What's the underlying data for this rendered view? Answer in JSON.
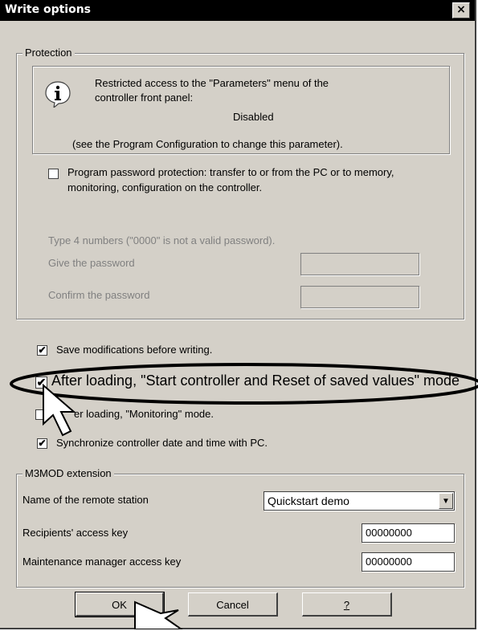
{
  "window": {
    "title": "Write options",
    "close_label": "×"
  },
  "protection": {
    "legend": "Protection",
    "info_line1": "Restricted access to the \"Parameters\" menu of the",
    "info_line2": "controller front panel:",
    "info_status": "Disabled",
    "info_note": "(see the Program Configuration to change this parameter).",
    "password_protection": {
      "checked": false,
      "line1": "Program password protection: transfer to or from the PC or to memory,",
      "line2": "monitoring, configuration on the controller."
    },
    "type_hint": "Type 4 numbers (\"0000\" is not a valid password).",
    "give_label": "Give the password",
    "give_value": "",
    "confirm_label": "Confirm the password",
    "confirm_value": ""
  },
  "options": {
    "save_mods": {
      "checked": true,
      "mark": "✔",
      "label": "Save modifications before writing."
    },
    "after_loading_start": {
      "checked": true,
      "mark": "✔",
      "label": "After loading, \"Start controller and Reset of saved values\" mode"
    },
    "after_loading_monitoring": {
      "checked": false,
      "mark": "",
      "label": "er loading, \"Monitoring\" mode."
    },
    "sync_time": {
      "checked": true,
      "mark": "✔",
      "label": "Synchronize controller date and time with PC."
    }
  },
  "m3mod": {
    "legend": "M3MOD extension",
    "station_label": "Name of the remote station",
    "station_value": "Quickstart demo",
    "recipients_label": "Recipients' access key",
    "recipients_value": "00000000",
    "maintenance_label": "Maintenance manager access key",
    "maintenance_value": "00000000"
  },
  "buttons": {
    "ok": "OK",
    "cancel": "Cancel",
    "help": "?"
  },
  "icons": {
    "info": "info-icon",
    "dropdown": "chevron-down-icon",
    "cursor": "mouse-pointer-icon"
  }
}
